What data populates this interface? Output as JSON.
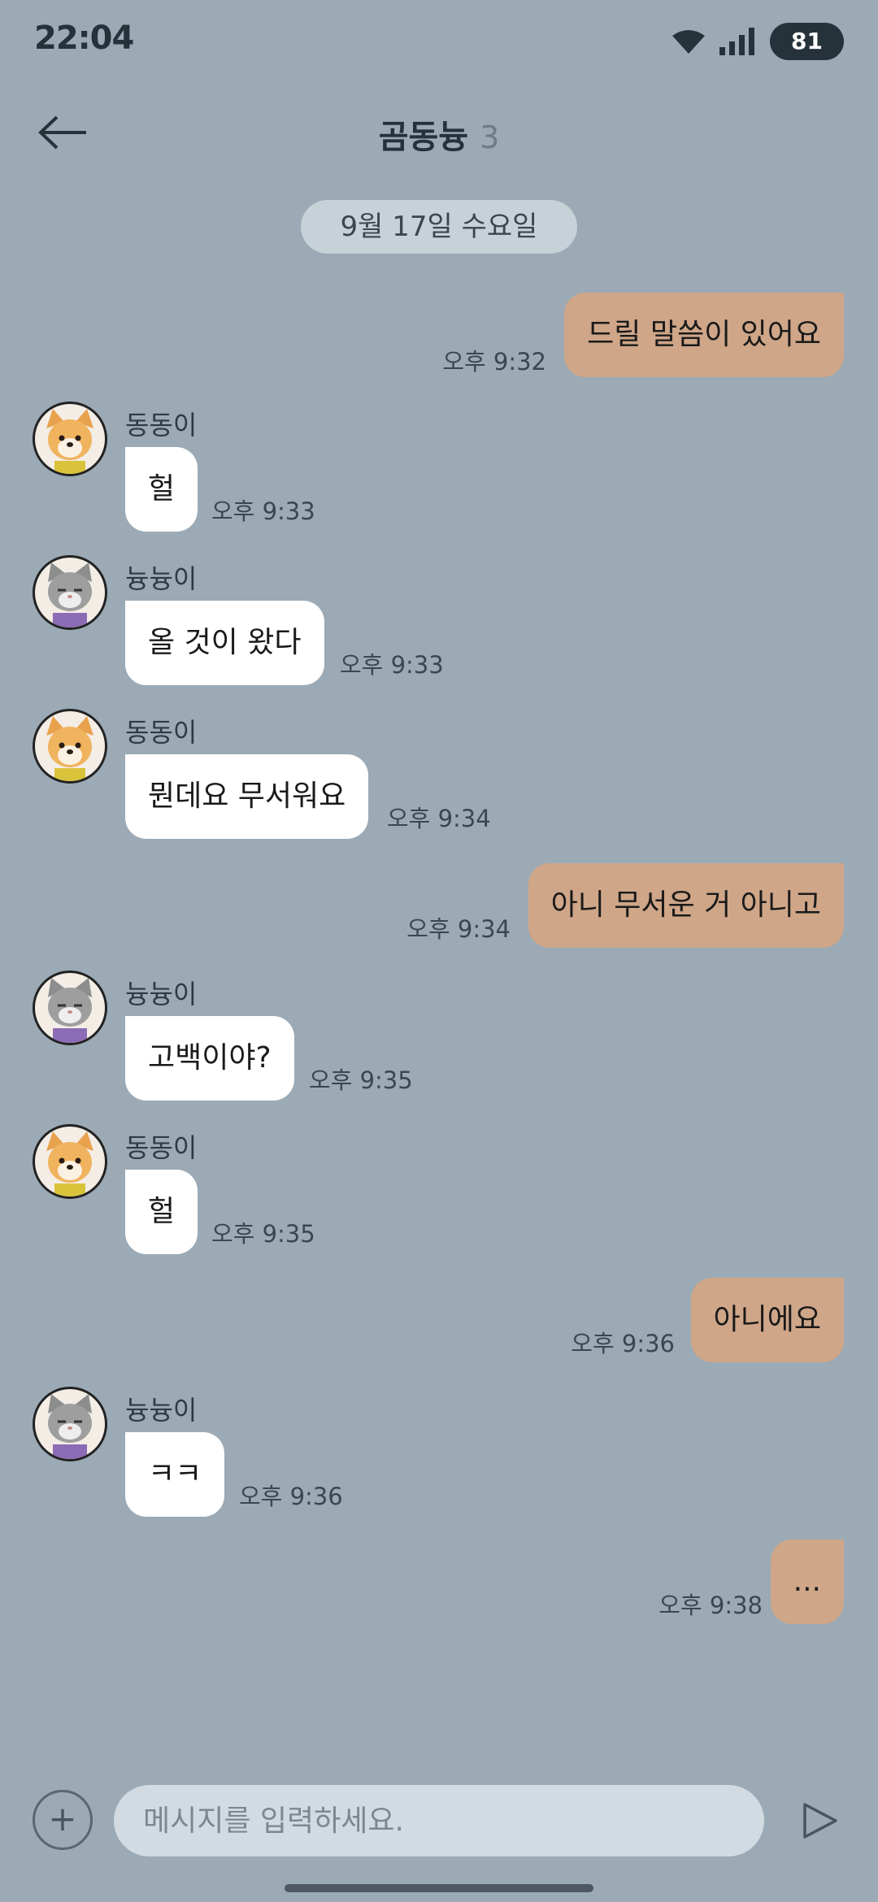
{
  "status_bar": {
    "time": "22:04",
    "battery": "81"
  },
  "header": {
    "title": "곰동늉",
    "member_count": "3"
  },
  "date_divider": "9월 17일 수요일",
  "messages": [
    {
      "sender": "",
      "text": "드릴 말씀이 있어요",
      "time": "오후 9:32",
      "outgoing": true
    },
    {
      "sender": "동동이",
      "avatar": "dog-avatar",
      "text": "헐",
      "time": "오후 9:33",
      "outgoing": false
    },
    {
      "sender": "늉늉이",
      "avatar": "cat-avatar",
      "text": "올 것이 왔다",
      "time": "오후 9:33",
      "outgoing": false
    },
    {
      "sender": "동동이",
      "avatar": "dog-avatar",
      "text": "뭔데요 무서워요",
      "time": "오후 9:34",
      "outgoing": false
    },
    {
      "sender": "",
      "text": "아니 무서운 거 아니고",
      "time": "오후 9:34",
      "outgoing": true
    },
    {
      "sender": "늉늉이",
      "avatar": "cat-avatar",
      "text": "고백이야?",
      "time": "오후 9:35",
      "outgoing": false
    },
    {
      "sender": "동동이",
      "avatar": "dog-avatar",
      "text": "헐",
      "time": "오후 9:35",
      "outgoing": false
    },
    {
      "sender": "",
      "text": "아니에요",
      "time": "오후 9:36",
      "outgoing": true
    },
    {
      "sender": "늉늉이",
      "avatar": "cat-avatar",
      "text": "ㅋㅋ",
      "time": "오후 9:36",
      "outgoing": false
    },
    {
      "sender": "",
      "text": "...",
      "time": "오후 9:38",
      "outgoing": true
    }
  ],
  "input": {
    "placeholder": "메시지를 입력하세요.",
    "value": ""
  },
  "icons": {
    "back": "arrow-left-icon",
    "attach": "plus-icon",
    "send": "send-icon",
    "wifi": "wifi-icon",
    "signal": "signal-icon"
  },
  "colors": {
    "background": "#9BAAB5",
    "outgoing_bubble": "#CFA688",
    "incoming_bubble": "#FFFFFF",
    "date_pill": "#C7D1D8",
    "input_field": "#D2DBE2"
  }
}
